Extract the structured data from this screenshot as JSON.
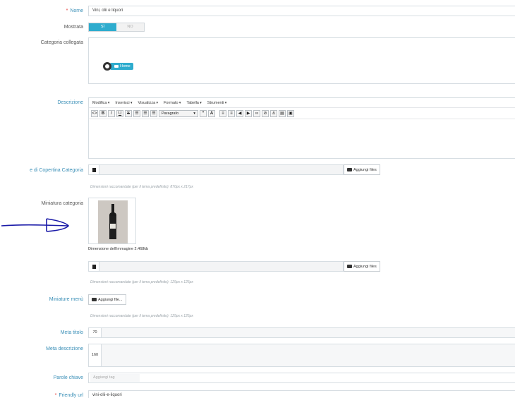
{
  "form": {
    "nome": {
      "label": "Nome",
      "required_mark": "*",
      "value": "Vini, olii e liquori"
    },
    "mostrata": {
      "label": "Mostrata",
      "on": "SÌ",
      "off": "NO",
      "selected": "SÌ"
    },
    "categoria": {
      "label": "Categoria collegata",
      "tree_root": "Home"
    },
    "descrizione": {
      "label": "Descrizione",
      "menus": [
        "Modifica",
        "Inserisci",
        "Visualizza",
        "Formato",
        "Tabella",
        "Strumenti"
      ],
      "format_select": "Paragrafo",
      "toolbar_icons": [
        "code-icon",
        "bold-icon",
        "italic-icon",
        "underline-icon",
        "strikethrough-icon",
        "align-left-icon",
        "align-center-icon",
        "align-right-icon",
        "blockquote-icon",
        "font-color-icon",
        "bullet-list-icon",
        "numbered-list-icon",
        "outdent-icon",
        "indent-icon",
        "link-icon",
        "unlink-icon",
        "anchor-icon",
        "table-icon",
        "image-icon"
      ]
    },
    "copertina": {
      "label": "e di Copertina Categoria",
      "button": "Aggiungi files",
      "hint": "Dimensioni raccomandate (per il tema predefinito): 870px x 217px"
    },
    "miniatura": {
      "label": "Miniatura categoria",
      "size_text": "Dimensione dell'immagine 2.468kb",
      "button": "Aggiungi files",
      "hint": "Dimensioni raccomandate (per il tema predefinito): 125px x 125px"
    },
    "miniature_menu": {
      "label": "Miniature menù",
      "button": "Aggiungi file...",
      "hint": "Dimensioni raccomandate (per il tema predefinito): 125px x 125px"
    },
    "meta_titolo": {
      "label": "Meta titolo",
      "counter": "70"
    },
    "meta_descrizione": {
      "label": "Meta descrizione",
      "counter": "160"
    },
    "parole_chiave": {
      "label": "Parole chiave",
      "placeholder": "Aggiungi tag"
    },
    "friendly_url": {
      "label": "Friendly url",
      "required_mark": "*",
      "value": "vini-olii-e-liquori"
    }
  },
  "colors": {
    "accent": "#2eacce",
    "label_highlight": "#3a8fb7",
    "required": "#e53935",
    "annotation": "#1a1aa8"
  }
}
